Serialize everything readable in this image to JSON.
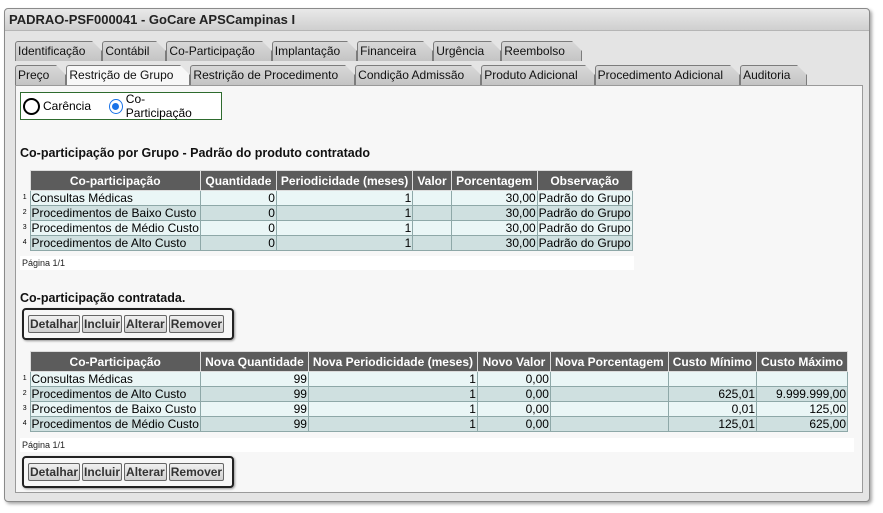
{
  "window": {
    "title": "PADRAO-PSF000041 - GoCare APSCampinas I"
  },
  "tabs_row1": [
    "Identificação",
    "Contábil",
    "Co-Participação",
    "Implantação",
    "Financeira",
    "Urgência",
    "Reembolso"
  ],
  "tabs_row2": [
    "Preço",
    "Restrição de Grupo",
    "Restrição de Procedimento",
    "Condição Admissão",
    "Produto Adicional",
    "Procedimento Adicional",
    "Auditoria"
  ],
  "radio": {
    "carencia": "Carência",
    "coparticipacao": "Co-Participação",
    "selected": "coparticipacao"
  },
  "section1": {
    "title": "Co-participação por Grupo - Padrão do produto contratado",
    "headers": [
      "Co-participação",
      "Quantidade",
      "Periodicidade (meses)",
      "Valor",
      "Porcentagem",
      "Observação"
    ],
    "rows": [
      [
        "Consultas Médicas",
        "0",
        "1",
        "",
        "30,00",
        "Padrão do Grupo"
      ],
      [
        "Procedimentos de Baixo Custo",
        "0",
        "1",
        "",
        "30,00",
        "Padrão do Grupo"
      ],
      [
        "Procedimentos de Médio Custo",
        "0",
        "1",
        "",
        "30,00",
        "Padrão do Grupo"
      ],
      [
        "Procedimentos de Alto Custo",
        "0",
        "1",
        "",
        "30,00",
        "Padrão do Grupo"
      ]
    ],
    "pager": "Página 1/1"
  },
  "section2": {
    "title": "Co-participação contratada.",
    "buttons": [
      "Detalhar",
      "Incluir",
      "Alterar",
      "Remover"
    ],
    "headers": [
      "Co-Participação",
      "Nova Quantidade",
      "Nova Periodicidade (meses)",
      "Novo Valor",
      "Nova Porcentagem",
      "Custo Mínimo",
      "Custo Máximo"
    ],
    "rows": [
      [
        "Consultas Médicas",
        "99",
        "1",
        "0,00",
        "",
        "",
        ""
      ],
      [
        "Procedimentos de Alto Custo",
        "99",
        "1",
        "0,00",
        "",
        "625,01",
        "9.999.999,00"
      ],
      [
        "Procedimentos de Baixo Custo",
        "99",
        "1",
        "0,00",
        "",
        "0,01",
        "125,00"
      ],
      [
        "Procedimentos de Médio Custo",
        "99",
        "1",
        "0,00",
        "",
        "125,01",
        "625,00"
      ]
    ],
    "pager": "Página 1/1"
  },
  "bottom_buttons": [
    "Detalhar",
    "Incluir",
    "Alterar",
    "Remover"
  ],
  "row_numbers": [
    "1",
    "2",
    "3",
    "4"
  ]
}
